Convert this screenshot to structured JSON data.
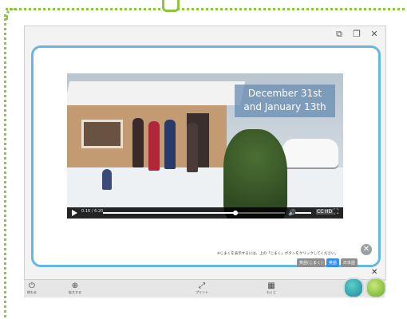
{
  "window": {
    "controls": [
      "⧉",
      "❐",
      "✕"
    ]
  },
  "video": {
    "caption_line1": "December 31st",
    "caption_line2": "and January 13th",
    "time": "0:16 / 6:20",
    "progress": 0.73,
    "volume_icon": "🔊",
    "cc_label": "CC",
    "hd_label": "HD",
    "fullscreen_icon": "⛶"
  },
  "subtitles": {
    "hint": "※じまくを表示するには、上の「じまく」ボタンをクリックしてください。",
    "off_label": "英語(じまく)",
    "en_label": "英語",
    "ja_label": "日本語"
  },
  "overlay": {
    "close": "✕",
    "small_close": "✕"
  },
  "toolbar": {
    "power_label": "終わる",
    "zoom_label": "拡大する",
    "center_label": "プリント",
    "grid_label": "もくじ",
    "left_icon": "⏻",
    "zoom_icon": "⊕",
    "center_icon": "⤢",
    "grid_icon": "▦"
  },
  "colors": {
    "panel_border": "#66b8e0",
    "accent_green": "#8cc63f",
    "caption_bg": "#678cb2",
    "sub_active": "#3a8ee6",
    "sub_inactive": "#8e8e8e"
  }
}
